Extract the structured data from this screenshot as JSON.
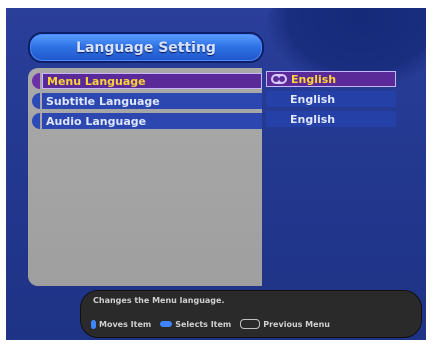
{
  "title": "Language Setting",
  "menu": {
    "items": [
      {
        "label": "Menu Language",
        "value": "English"
      },
      {
        "label": "Subtitle Language",
        "value": "English"
      },
      {
        "label": "Audio Language",
        "value": "English"
      }
    ]
  },
  "help": {
    "description": "Changes the Menu language.",
    "moves_label": "Moves Item",
    "selects_label": "Selects Item",
    "previous_label": "Previous Menu"
  },
  "colors": {
    "background": "#23388f",
    "title_pill": "#2f73e6",
    "selected_bg": "#5a2b98",
    "selected_text": "#ffd23a",
    "panel": "#a9a9a9",
    "help_bar": "#2a2a2a"
  },
  "icons": {
    "moves": "up-down-icon",
    "selects": "left-right-icon",
    "previous": "exit-button-icon"
  }
}
